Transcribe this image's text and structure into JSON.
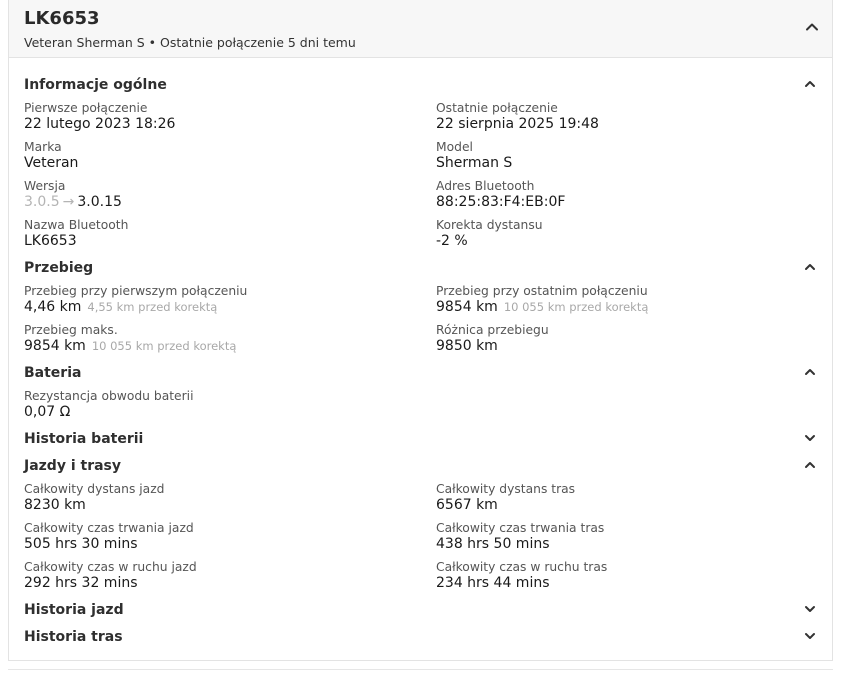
{
  "header": {
    "title": "LK6653",
    "subtitle": "Veteran Sherman S • Ostatnie połączenie 5 dni temu"
  },
  "sections": {
    "general": {
      "label": "Informacje ogólne",
      "first_conn_key": "Pierwsze połączenie",
      "first_conn_val": "22 lutego 2023 18:26",
      "last_conn_key": "Ostatnie połączenie",
      "last_conn_val": "22 sierpnia 2025 19:48",
      "brand_key": "Marka",
      "brand_val": "Veteran",
      "model_key": "Model",
      "model_val": "Sherman S",
      "version_key": "Wersja",
      "version_old": "3.0.5",
      "version_arrow": "→",
      "version_new": "3.0.15",
      "bt_addr_key": "Adres Bluetooth",
      "bt_addr_val": "88:25:83:F4:EB:0F",
      "bt_name_key": "Nazwa Bluetooth",
      "bt_name_val": "LK6653",
      "dist_corr_key": "Korekta dystansu",
      "dist_corr_val": "-2 %"
    },
    "mileage": {
      "label": "Przebieg",
      "first_key": "Przebieg przy pierwszym połączeniu",
      "first_val": "4,46 km",
      "first_note": "4,55 km przed korektą",
      "last_key": "Przebieg przy ostatnim połączeniu",
      "last_val": "9854 km",
      "last_note": "10 055 km przed korektą",
      "max_key": "Przebieg maks.",
      "max_val": "9854 km",
      "max_note": "10 055 km przed korektą",
      "diff_key": "Różnica przebiegu",
      "diff_val": "9850 km"
    },
    "battery": {
      "label": "Bateria",
      "res_key": "Rezystancja obwodu baterii",
      "res_val": "0,07 Ω"
    },
    "battery_history": {
      "label": "Historia baterii"
    },
    "rides": {
      "label": "Jazdy i trasy",
      "ride_dist_key": "Całkowity dystans jazd",
      "ride_dist_val": "8230 km",
      "trip_dist_key": "Całkowity dystans tras",
      "trip_dist_val": "6567 km",
      "ride_dur_key": "Całkowity czas trwania jazd",
      "ride_dur_val": "505 hrs 30 mins",
      "trip_dur_key": "Całkowity czas trwania tras",
      "trip_dur_val": "438 hrs 50 mins",
      "ride_move_key": "Całkowity czas w ruchu jazd",
      "ride_move_val": "292 hrs 32 mins",
      "trip_move_key": "Całkowity czas w ruchu tras",
      "trip_move_val": "234 hrs 44 mins"
    },
    "ride_history": {
      "label": "Historia jazd"
    },
    "trip_history": {
      "label": "Historia tras"
    }
  },
  "icons": {
    "expanded": "chevron-up-icon",
    "collapsed": "chevron-down-icon"
  }
}
